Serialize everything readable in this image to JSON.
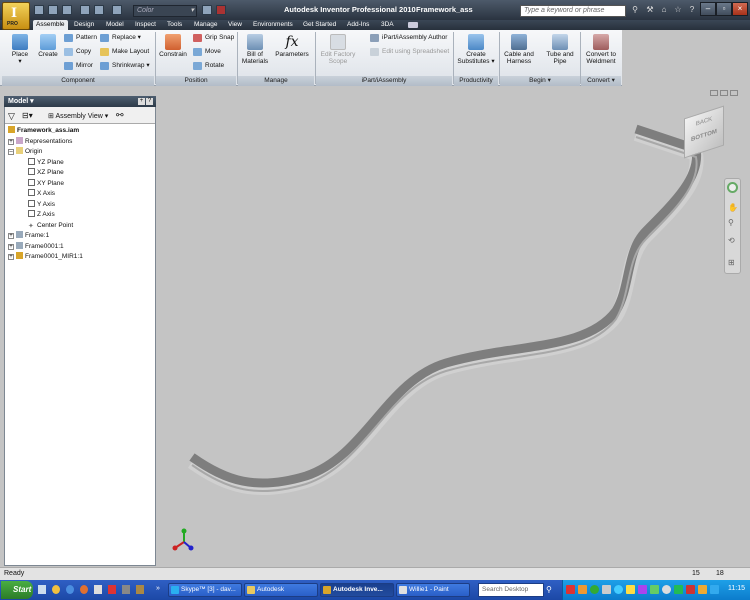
{
  "titlebar": {
    "app_title": "Autodesk Inventor Professional 2010",
    "doc_name": "Framework_ass",
    "color_placeholder": "Color",
    "search_placeholder": "Type a keyword or phrase",
    "app_button_label": "PRO"
  },
  "tabs": [
    "Assemble",
    "Design",
    "Model",
    "Inspect",
    "Tools",
    "Manage",
    "View",
    "Environments",
    "Get Started",
    "Add-Ins",
    "3DA"
  ],
  "ribbon": {
    "component": {
      "panel": "Component",
      "place": "Place",
      "create": "Create",
      "pattern": "Pattern",
      "copy": "Copy",
      "mirror": "Mirror",
      "replace": "Replace",
      "make_layout": "Make Layout",
      "shrinkwrap": "Shrinkwrap"
    },
    "position": {
      "panel": "Position",
      "constrain": "Constrain",
      "grip_snap": "Grip Snap",
      "move": "Move",
      "rotate": "Rotate"
    },
    "manage": {
      "panel": "Manage",
      "bom": "Bill of Materials",
      "parameters": "Parameters"
    },
    "ipart": {
      "panel": "iPart/iAssembly",
      "edit_factory": "Edit Factory Scope",
      "author": "iPart/iAssembly Author",
      "edit_spreadsheet": "Edit using Spreadsheet"
    },
    "productivity": {
      "panel": "Productivity",
      "create_subs": "Create Substitutes"
    },
    "begin": {
      "panel": "Begin",
      "cable": "Cable and Harness",
      "tube": "Tube and Pipe"
    },
    "convert": {
      "panel": "Convert",
      "weldment": "Convert to Weldment"
    }
  },
  "browser": {
    "title": "Model",
    "view_mode": "Assembly View",
    "items": [
      "Framework_ass.iam",
      "Representations",
      "Origin",
      "YZ Plane",
      "XZ Plane",
      "XY Plane",
      "X Axis",
      "Y Axis",
      "Z Axis",
      "Center Point",
      "Frame:1",
      "Frame0001:1",
      "Frame0001_MIR1:1"
    ]
  },
  "viewcube": {
    "top_face": "BACK",
    "front_face": "BOTTOM"
  },
  "status": {
    "text": "Ready",
    "num1": "15",
    "num2": "18"
  },
  "taskbar": {
    "start": "Start",
    "buttons": [
      "Skype™ [3] - dav...",
      "Autodesk",
      "Autodesk Inve...",
      "Willie1 - Paint"
    ],
    "search_placeholder": "Search Desktop",
    "clock": "11:15"
  },
  "colors": {
    "ribbon_bg": "#e9ecef",
    "viewport_bg": "#c4c4c4",
    "taskbar": "#2a5fc8",
    "part_dark": "#7b7b7b",
    "part_light": "#a9a9a9"
  }
}
